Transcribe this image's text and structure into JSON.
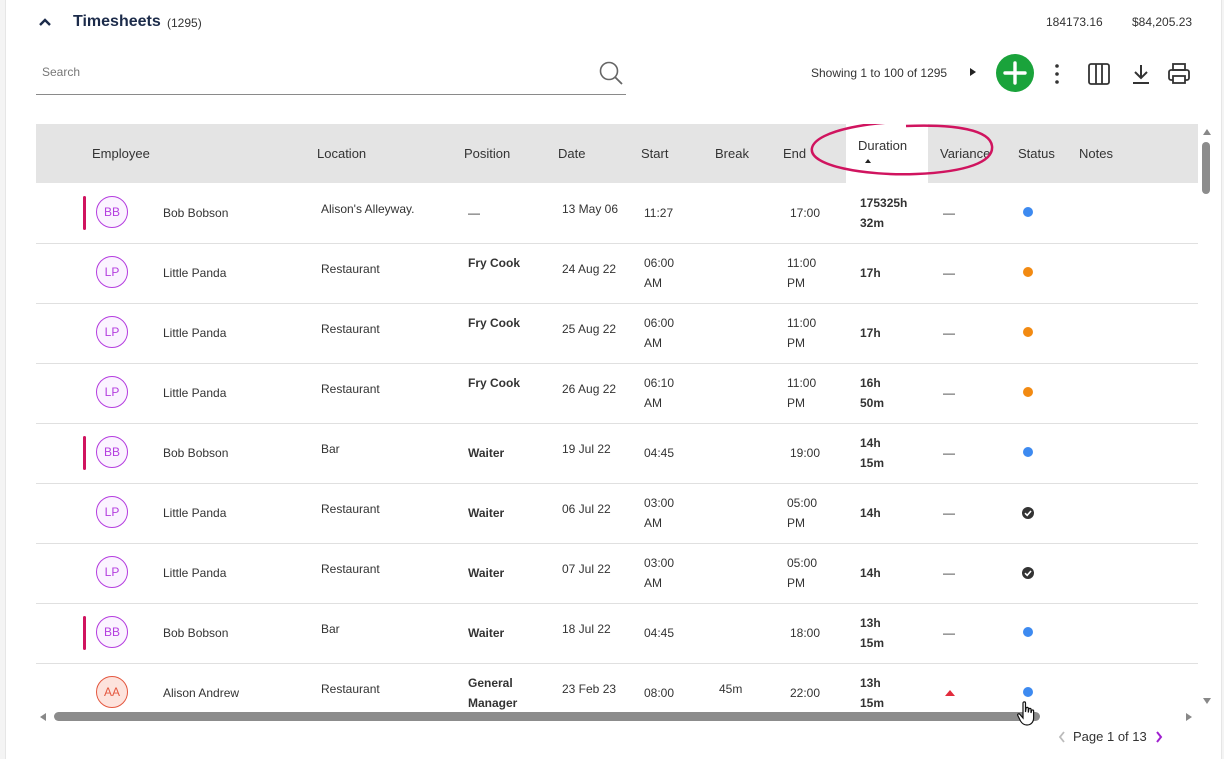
{
  "header": {
    "title": "Timesheets",
    "count": "(1295)",
    "total_hours": "184173.16",
    "total_cost": "$84,205.23"
  },
  "search": {
    "placeholder": "Search",
    "value": ""
  },
  "toolbar": {
    "showing": "Showing 1 to 100 of 1295"
  },
  "table": {
    "columns": [
      "Employee",
      "Location",
      "Position",
      "Date",
      "Start",
      "Break",
      "End",
      "Duration",
      "Variance",
      "Status",
      "Notes"
    ],
    "sorted_column": "Duration",
    "rows": [
      {
        "initials": "BB",
        "name": "Bob Bobson",
        "flag": true,
        "location": "Alison's Alleyway.",
        "position": "—",
        "date": "13 May 06",
        "start": [
          "11:27"
        ],
        "break": "",
        "end": [
          "17:00"
        ],
        "duration": [
          "175325h",
          "32m"
        ],
        "variance": "—",
        "status": "blue"
      },
      {
        "initials": "LP",
        "name": "Little Panda",
        "flag": false,
        "location": "Restaurant",
        "position": "Fry Cook",
        "date": "24 Aug 22",
        "start": [
          "06:00",
          "AM"
        ],
        "break": "",
        "end": [
          "11:00",
          "PM"
        ],
        "duration": [
          "17h"
        ],
        "variance": "—",
        "status": "orange"
      },
      {
        "initials": "LP",
        "name": "Little Panda",
        "flag": false,
        "location": "Restaurant",
        "position": "Fry Cook",
        "date": "25 Aug 22",
        "start": [
          "06:00",
          "AM"
        ],
        "break": "",
        "end": [
          "11:00",
          "PM"
        ],
        "duration": [
          "17h"
        ],
        "variance": "—",
        "status": "orange"
      },
      {
        "initials": "LP",
        "name": "Little Panda",
        "flag": false,
        "location": "Restaurant",
        "position": "Fry Cook",
        "date": "26 Aug 22",
        "start": [
          "06:10",
          "AM"
        ],
        "break": "",
        "end": [
          "11:00",
          "PM"
        ],
        "duration": [
          "16h",
          "50m"
        ],
        "variance": "—",
        "status": "orange"
      },
      {
        "initials": "BB",
        "name": "Bob Bobson",
        "flag": true,
        "location": "Bar",
        "position": "Waiter",
        "date": "19 Jul 22",
        "start": [
          "04:45"
        ],
        "break": "",
        "end": [
          "19:00"
        ],
        "duration": [
          "14h",
          "15m"
        ],
        "variance": "—",
        "status": "blue"
      },
      {
        "initials": "LP",
        "name": "Little Panda",
        "flag": false,
        "location": "Restaurant",
        "position": "Waiter",
        "date": "06 Jul 22",
        "start": [
          "03:00",
          "AM"
        ],
        "break": "",
        "end": [
          "05:00",
          "PM"
        ],
        "duration": [
          "14h"
        ],
        "variance": "—",
        "status": "approved"
      },
      {
        "initials": "LP",
        "name": "Little Panda",
        "flag": false,
        "location": "Restaurant",
        "position": "Waiter",
        "date": "07 Jul 22",
        "start": [
          "03:00",
          "AM"
        ],
        "break": "",
        "end": [
          "05:00",
          "PM"
        ],
        "duration": [
          "14h"
        ],
        "variance": "—",
        "status": "approved"
      },
      {
        "initials": "BB",
        "name": "Bob Bobson",
        "flag": true,
        "location": "Bar",
        "position": "Waiter",
        "date": "18 Jul 22",
        "start": [
          "04:45"
        ],
        "break": "",
        "end": [
          "18:00"
        ],
        "duration": [
          "13h",
          "15m"
        ],
        "variance": "—",
        "status": "blue"
      },
      {
        "initials": "AA",
        "name": "Alison Andrew",
        "flag": false,
        "location": "Restaurant",
        "position": "General Manager",
        "date": "23 Feb 23",
        "start": [
          "08:00"
        ],
        "break": "45m",
        "end": [
          "22:00"
        ],
        "duration": [
          "13h",
          "15m"
        ],
        "variance": "up",
        "status": "blue"
      }
    ]
  },
  "pagination": {
    "label": "Page 1 of 13"
  },
  "colors": {
    "add": "#1aa33b",
    "flag": "#d0145f",
    "blue": "#3d8af0",
    "orange": "#f28a12",
    "highlight": "#d0145f"
  }
}
